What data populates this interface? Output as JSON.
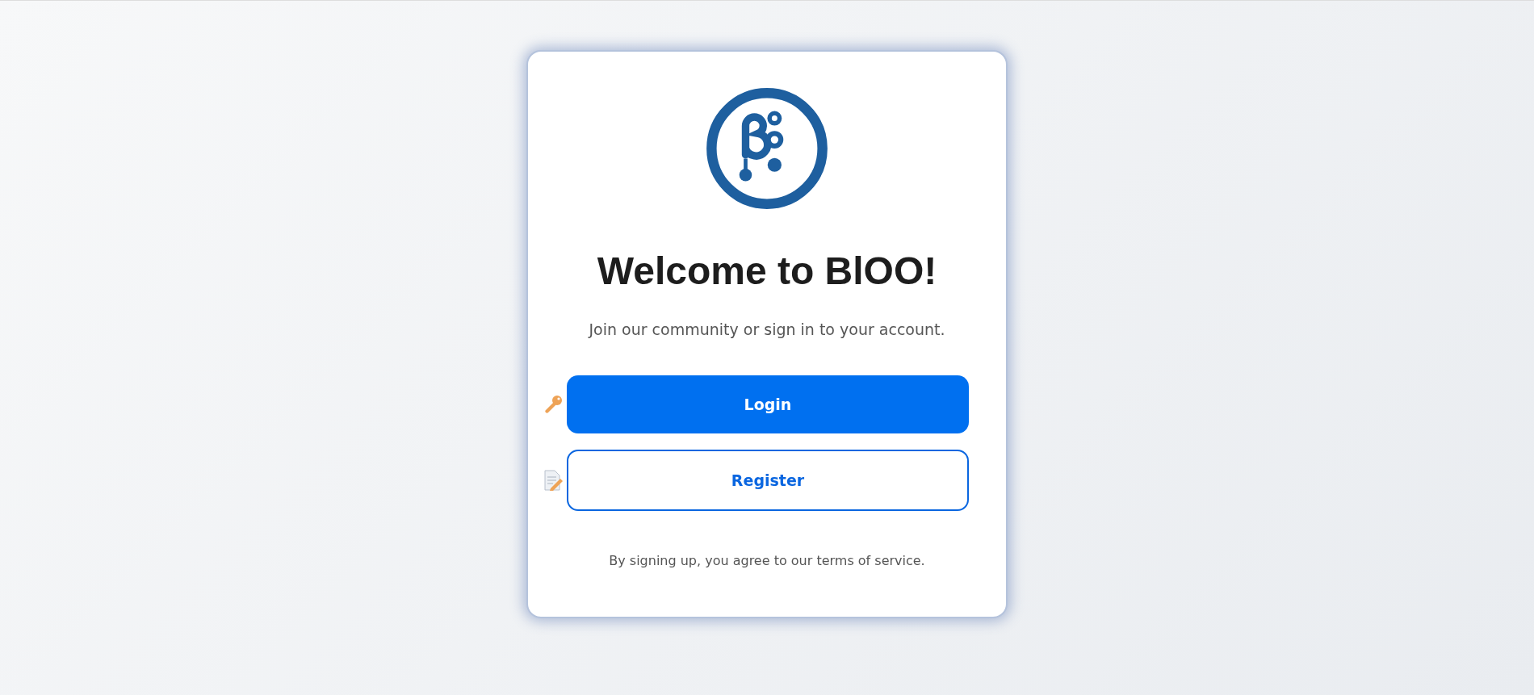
{
  "card": {
    "title": "Welcome to BlOO!",
    "subtitle": "Join our community or sign in to your account.",
    "buttons": [
      {
        "label": "Login",
        "kind": "primary"
      },
      {
        "label": "Register",
        "kind": "outline"
      }
    ],
    "footer": "By signing up, you agree to our terms of service."
  }
}
